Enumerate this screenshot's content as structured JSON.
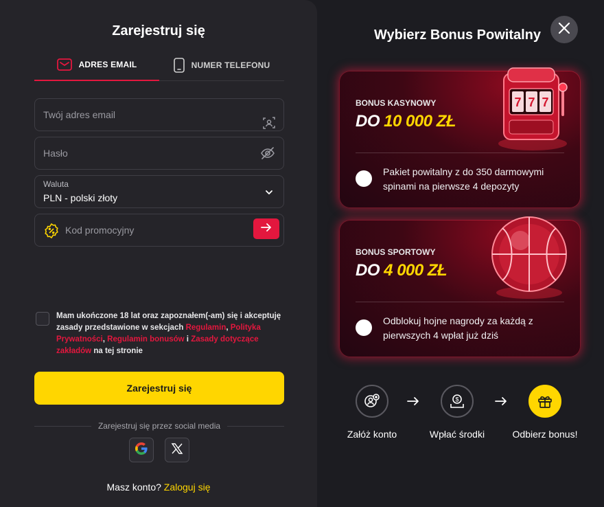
{
  "register": {
    "title": "Zarejestruj się",
    "tabs": [
      {
        "label": "ADRES EMAIL",
        "icon": "envelope-icon",
        "active": true
      },
      {
        "label": "NUMER TELEFONU",
        "icon": "phone-icon",
        "active": false
      }
    ],
    "email_placeholder": "Twój adres email",
    "password_placeholder": "Hasło",
    "currency": {
      "label": "Waluta",
      "value": "PLN - polski złoty"
    },
    "promo_placeholder": "Kod promocyjny",
    "consent": {
      "part1": "Mam ukończone 18 lat oraz zapoznałem(-am) się i akceptuję zasady przedstawione w sekcjach ",
      "link1": "Regulamin",
      "sep1": ", ",
      "link2": "Polityka Prywatności",
      "sep2": ", ",
      "link3": "Regulamin bonusów",
      "sep3": " i ",
      "link4": "Zasady dotyczące zakładów",
      "part2": " na tej stronie"
    },
    "submit_label": "Zarejestruj się",
    "social_label": "Zarejestruj się przez social media",
    "have_account": "Masz konto?",
    "login_link": "Zaloguj się"
  },
  "bonus": {
    "title": "Wybierz Bonus Powitalny",
    "cards": [
      {
        "category": "BONUS KASYNOWY",
        "prefix": "DO ",
        "amount": "10 000 ZŁ",
        "description": "Pakiet powitalny z do 350 darmowymi spinami na pierwsze 4 depozyty",
        "art": "slot-machine-icon"
      },
      {
        "category": "BONUS SPORTOWY",
        "prefix": "DO ",
        "amount": "4 000 ZŁ",
        "description": "Odblokuj hojne nagrody za każdą z pierwszych 4 wpłat już dziś",
        "art": "basketball-icon"
      }
    ],
    "steps": [
      {
        "label": "Załóż konto",
        "icon": "add-user-icon"
      },
      {
        "label": "Wpłać środki",
        "icon": "deposit-icon"
      },
      {
        "label": "Odbierz bonus!",
        "icon": "gift-icon"
      }
    ]
  },
  "colors": {
    "accent_red": "#e3173e",
    "accent_yellow": "#ffd600",
    "panel": "#252429",
    "background": "#1c1c21"
  }
}
